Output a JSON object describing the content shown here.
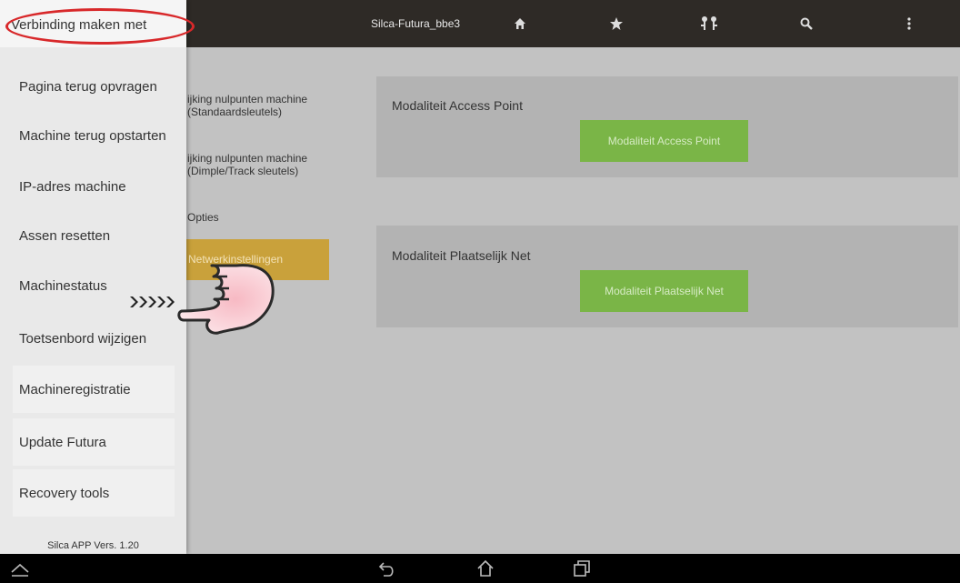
{
  "topbar": {
    "device_name": "Silca-Futura_bbe3",
    "icons": [
      "home-icon",
      "star-icon",
      "key-pair-icon",
      "search-icon",
      "overflow-menu-icon"
    ]
  },
  "drawer": {
    "items": [
      {
        "label": "Verbinding maken met"
      },
      {
        "label": "Pagina terug opvragen"
      },
      {
        "label": "Machine terug opstarten"
      },
      {
        "label": "IP-adres machine"
      },
      {
        "label": "Assen resetten"
      },
      {
        "label": "Machinestatus"
      },
      {
        "label": "Toetsenbord wijzigen"
      },
      {
        "label": "Machineregistratie"
      },
      {
        "label": "Update Futura"
      },
      {
        "label": "Recovery tools"
      }
    ],
    "version": "Silca APP Vers. 1.20"
  },
  "submenu": {
    "item1_line1": "ijking nulpunten machine",
    "item1_line2": "(Standaardsleutels)",
    "item2_line1": "ijking nulpunten machine",
    "item2_line2": "(Dimple/Track sleutels)",
    "item3": "Opties",
    "item4": "Netwerkinstellingen"
  },
  "panels": {
    "access_point": {
      "title": "Modaliteit Access Point",
      "button": "Modaliteit Access Point"
    },
    "local_net": {
      "title": "Modaliteit Plaatselijk Net",
      "button": "Modaliteit Plaatselijk Net"
    }
  },
  "colors": {
    "topbar": "#2e2a26",
    "accent_orange": "#c9a13b",
    "button_green": "#7ab547",
    "highlight_red": "#d8282a"
  },
  "navbar": {
    "icons": [
      "hide-keyboard-icon",
      "back-icon",
      "home-icon",
      "recent-apps-icon"
    ]
  }
}
